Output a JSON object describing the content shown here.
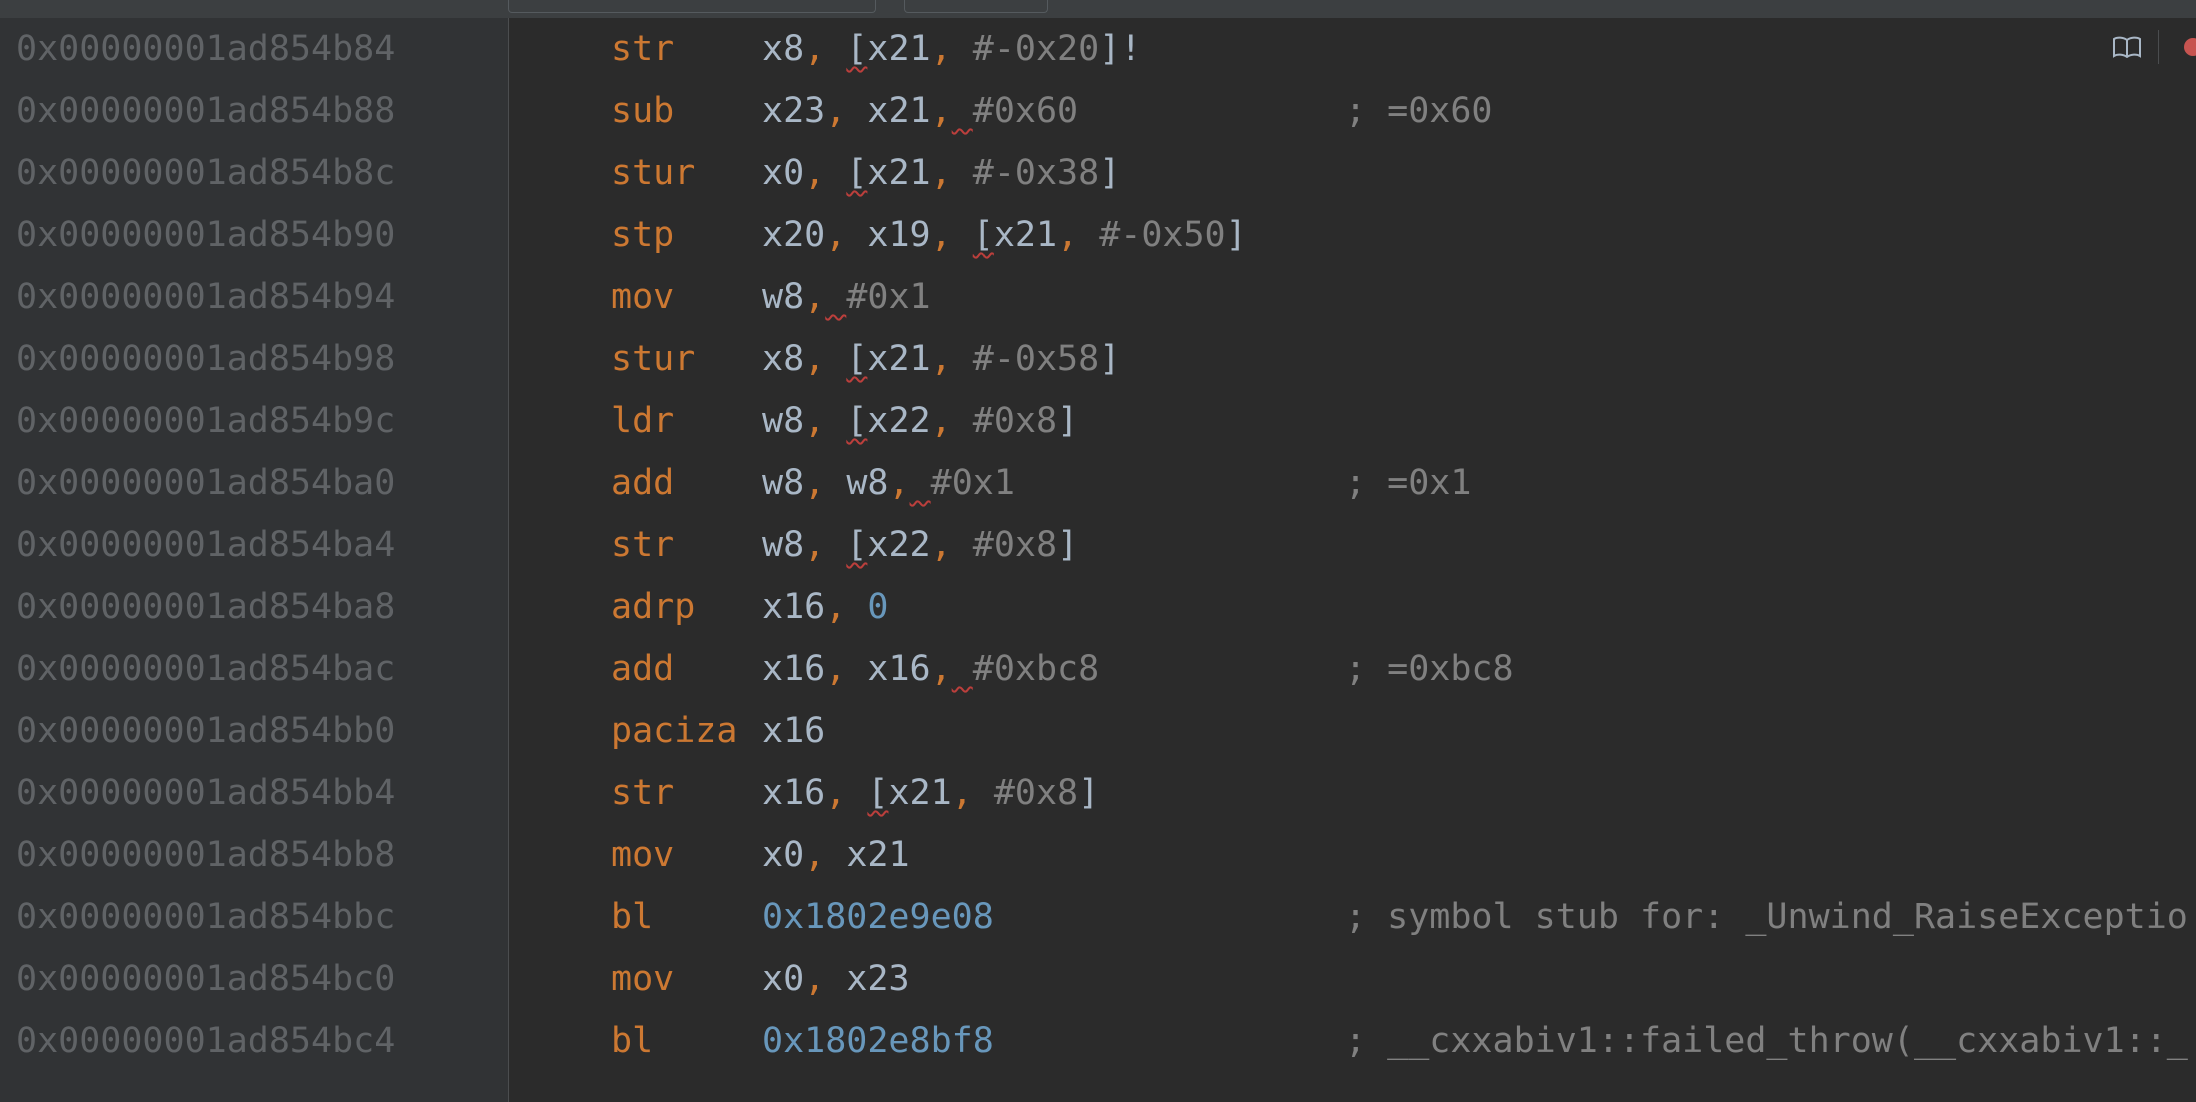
{
  "rows": [
    {
      "address": "0x00000001ad854b84",
      "mnemonic": "str",
      "operands": [
        {
          "t": "x8",
          "s": "reg"
        },
        {
          "t": ", ",
          "s": "p"
        },
        {
          "t": "[",
          "s": "reg sq"
        },
        {
          "t": "x21",
          "s": "reg"
        },
        {
          "t": ", ",
          "s": "p"
        },
        {
          "t": "#-0x20",
          "s": "g"
        },
        {
          "t": "]!",
          "s": "reg"
        }
      ],
      "comment": ""
    },
    {
      "address": "0x00000001ad854b88",
      "mnemonic": "sub",
      "operands": [
        {
          "t": "x23",
          "s": "reg"
        },
        {
          "t": ", ",
          "s": "p"
        },
        {
          "t": "x21",
          "s": "reg"
        },
        {
          "t": ",",
          "s": "p"
        },
        {
          "t": " ",
          "s": "sq"
        },
        {
          "t": "#0x60",
          "s": "g"
        }
      ],
      "comment": "; =0x60"
    },
    {
      "address": "0x00000001ad854b8c",
      "mnemonic": "stur",
      "operands": [
        {
          "t": "x0",
          "s": "reg"
        },
        {
          "t": ", ",
          "s": "p"
        },
        {
          "t": "[",
          "s": "reg sq"
        },
        {
          "t": "x21",
          "s": "reg"
        },
        {
          "t": ", ",
          "s": "p"
        },
        {
          "t": "#-0x38",
          "s": "g"
        },
        {
          "t": "]",
          "s": "reg"
        }
      ],
      "comment": ""
    },
    {
      "address": "0x00000001ad854b90",
      "mnemonic": "stp",
      "operands": [
        {
          "t": "x20",
          "s": "reg"
        },
        {
          "t": ", ",
          "s": "p"
        },
        {
          "t": "x19",
          "s": "reg"
        },
        {
          "t": ", ",
          "s": "p"
        },
        {
          "t": "[",
          "s": "reg sq"
        },
        {
          "t": "x21",
          "s": "reg"
        },
        {
          "t": ", ",
          "s": "p"
        },
        {
          "t": "#-0x50",
          "s": "g"
        },
        {
          "t": "]",
          "s": "reg"
        }
      ],
      "comment": ""
    },
    {
      "address": "0x00000001ad854b94",
      "mnemonic": "mov",
      "operands": [
        {
          "t": "w8",
          "s": "reg"
        },
        {
          "t": ",",
          "s": "p"
        },
        {
          "t": " ",
          "s": "sq"
        },
        {
          "t": "#0x1",
          "s": "g"
        }
      ],
      "comment": ""
    },
    {
      "address": "0x00000001ad854b98",
      "mnemonic": "stur",
      "operands": [
        {
          "t": "x8",
          "s": "reg"
        },
        {
          "t": ", ",
          "s": "p"
        },
        {
          "t": "[",
          "s": "reg sq"
        },
        {
          "t": "x21",
          "s": "reg"
        },
        {
          "t": ", ",
          "s": "p"
        },
        {
          "t": "#-0x58",
          "s": "g"
        },
        {
          "t": "]",
          "s": "reg"
        }
      ],
      "comment": ""
    },
    {
      "address": "0x00000001ad854b9c",
      "mnemonic": "ldr",
      "operands": [
        {
          "t": "w8",
          "s": "reg"
        },
        {
          "t": ", ",
          "s": "p"
        },
        {
          "t": "[",
          "s": "reg sq"
        },
        {
          "t": "x22",
          "s": "reg"
        },
        {
          "t": ", ",
          "s": "p"
        },
        {
          "t": "#0x8",
          "s": "g"
        },
        {
          "t": "]",
          "s": "reg"
        }
      ],
      "comment": ""
    },
    {
      "address": "0x00000001ad854ba0",
      "mnemonic": "add",
      "operands": [
        {
          "t": "w8",
          "s": "reg"
        },
        {
          "t": ", ",
          "s": "p"
        },
        {
          "t": "w8",
          "s": "reg"
        },
        {
          "t": ",",
          "s": "p"
        },
        {
          "t": " ",
          "s": "sq"
        },
        {
          "t": "#0x1",
          "s": "g"
        }
      ],
      "comment": "; =0x1"
    },
    {
      "address": "0x00000001ad854ba4",
      "mnemonic": "str",
      "operands": [
        {
          "t": "w8",
          "s": "reg"
        },
        {
          "t": ", ",
          "s": "p"
        },
        {
          "t": "[",
          "s": "reg sq"
        },
        {
          "t": "x22",
          "s": "reg"
        },
        {
          "t": ", ",
          "s": "p"
        },
        {
          "t": "#0x8",
          "s": "g"
        },
        {
          "t": "]",
          "s": "reg"
        }
      ],
      "comment": ""
    },
    {
      "address": "0x00000001ad854ba8",
      "mnemonic": "adrp",
      "operands": [
        {
          "t": "x16",
          "s": "reg"
        },
        {
          "t": ", ",
          "s": "p"
        },
        {
          "t": "0",
          "s": "n"
        }
      ],
      "comment": ""
    },
    {
      "address": "0x00000001ad854bac",
      "mnemonic": "add",
      "operands": [
        {
          "t": "x16",
          "s": "reg"
        },
        {
          "t": ", ",
          "s": "p"
        },
        {
          "t": "x16",
          "s": "reg"
        },
        {
          "t": ",",
          "s": "p"
        },
        {
          "t": " ",
          "s": "sq"
        },
        {
          "t": "#0xbc8",
          "s": "g"
        }
      ],
      "comment": "; =0xbc8"
    },
    {
      "address": "0x00000001ad854bb0",
      "mnemonic": "paciza",
      "operands": [
        {
          "t": "x16",
          "s": "reg"
        }
      ],
      "comment": ""
    },
    {
      "address": "0x00000001ad854bb4",
      "mnemonic": "str",
      "operands": [
        {
          "t": "x16",
          "s": "reg"
        },
        {
          "t": ", ",
          "s": "p"
        },
        {
          "t": "[",
          "s": "reg sq"
        },
        {
          "t": "x21",
          "s": "reg"
        },
        {
          "t": ", ",
          "s": "p"
        },
        {
          "t": "#0x8",
          "s": "g"
        },
        {
          "t": "]",
          "s": "reg"
        }
      ],
      "comment": ""
    },
    {
      "address": "0x00000001ad854bb8",
      "mnemonic": "mov",
      "operands": [
        {
          "t": "x0",
          "s": "reg"
        },
        {
          "t": ", ",
          "s": "p"
        },
        {
          "t": "x21",
          "s": "reg"
        }
      ],
      "comment": ""
    },
    {
      "address": "0x00000001ad854bbc",
      "mnemonic": "bl",
      "operands": [
        {
          "t": "0x1802e9e08",
          "s": "n"
        }
      ],
      "comment": "; symbol stub for: _Unwind_RaiseExceptio"
    },
    {
      "address": "0x00000001ad854bc0",
      "mnemonic": "mov",
      "operands": [
        {
          "t": "x0",
          "s": "reg"
        },
        {
          "t": ", ",
          "s": "p"
        },
        {
          "t": "x23",
          "s": "reg"
        }
      ],
      "comment": ""
    },
    {
      "address": "0x00000001ad854bc4",
      "mnemonic": "bl",
      "operands": [
        {
          "t": "0x1802e8bf8",
          "s": "n"
        }
      ],
      "comment": "; __cxxabiv1::failed_throw(__cxxabiv1::_"
    }
  ],
  "icons": {
    "reader": "book-icon",
    "breakpoint": "breakpoint-dot-icon"
  },
  "colors": {
    "background": "#2b2b2b",
    "gutter": "#313335",
    "address": "#606366",
    "mnemonic": "#cc7832",
    "register": "#a9b7c6",
    "number": "#6897bb",
    "comment": "#808080",
    "squiggle": "#bc3f3c"
  }
}
